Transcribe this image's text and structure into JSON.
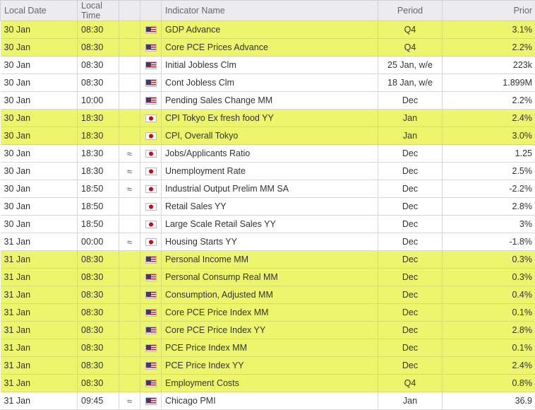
{
  "headers": {
    "date": "Local Date",
    "time": "Local Time",
    "indicator": "Indicator Name",
    "period": "Period",
    "prior": "Prior"
  },
  "rows": [
    {
      "date": "30 Jan",
      "time": "08:30",
      "rev": "",
      "flag": "us",
      "indicator": "GDP Advance",
      "period": "Q4",
      "prior": "3.1%",
      "hl": true
    },
    {
      "date": "30 Jan",
      "time": "08:30",
      "rev": "",
      "flag": "us",
      "indicator": "Core PCE Prices Advance",
      "period": "Q4",
      "prior": "2.2%",
      "hl": true
    },
    {
      "date": "30 Jan",
      "time": "08:30",
      "rev": "",
      "flag": "us",
      "indicator": "Initial Jobless Clm",
      "period": "25 Jan, w/e",
      "prior": "223k",
      "hl": false
    },
    {
      "date": "30 Jan",
      "time": "08:30",
      "rev": "",
      "flag": "us",
      "indicator": "Cont Jobless Clm",
      "period": "18 Jan, w/e",
      "prior": "1.899M",
      "hl": false
    },
    {
      "date": "30 Jan",
      "time": "10:00",
      "rev": "",
      "flag": "us",
      "indicator": "Pending Sales Change MM",
      "period": "Dec",
      "prior": "2.2%",
      "hl": false
    },
    {
      "date": "30 Jan",
      "time": "18:30",
      "rev": "",
      "flag": "jp",
      "indicator": "CPI Tokyo Ex fresh food YY",
      "period": "Jan",
      "prior": "2.4%",
      "hl": true
    },
    {
      "date": "30 Jan",
      "time": "18:30",
      "rev": "",
      "flag": "jp",
      "indicator": "CPI, Overall Tokyo",
      "period": "Jan",
      "prior": "3.0%",
      "hl": true
    },
    {
      "date": "30 Jan",
      "time": "18:30",
      "rev": "≈",
      "flag": "jp",
      "indicator": "Jobs/Applicants Ratio",
      "period": "Dec",
      "prior": "1.25",
      "hl": false
    },
    {
      "date": "30 Jan",
      "time": "18:30",
      "rev": "≈",
      "flag": "jp",
      "indicator": "Unemployment Rate",
      "period": "Dec",
      "prior": "2.5%",
      "hl": false
    },
    {
      "date": "30 Jan",
      "time": "18:50",
      "rev": "≈",
      "flag": "jp",
      "indicator": "Industrial Output Prelim MM SA",
      "period": "Dec",
      "prior": "-2.2%",
      "hl": false
    },
    {
      "date": "30 Jan",
      "time": "18:50",
      "rev": "",
      "flag": "jp",
      "indicator": "Retail Sales YY",
      "period": "Dec",
      "prior": "2.8%",
      "hl": false
    },
    {
      "date": "30 Jan",
      "time": "18:50",
      "rev": "",
      "flag": "jp",
      "indicator": "Large Scale Retail Sales YY",
      "period": "Dec",
      "prior": "3%",
      "hl": false
    },
    {
      "date": "31 Jan",
      "time": "00:00",
      "rev": "≈",
      "flag": "jp",
      "indicator": "Housing Starts YY",
      "period": "Dec",
      "prior": "-1.8%",
      "hl": false
    },
    {
      "date": "31 Jan",
      "time": "08:30",
      "rev": "",
      "flag": "us",
      "indicator": "Personal Income MM",
      "period": "Dec",
      "prior": "0.3%",
      "hl": true
    },
    {
      "date": "31 Jan",
      "time": "08:30",
      "rev": "",
      "flag": "us",
      "indicator": "Personal Consump Real MM",
      "period": "Dec",
      "prior": "0.3%",
      "hl": true
    },
    {
      "date": "31 Jan",
      "time": "08:30",
      "rev": "",
      "flag": "us",
      "indicator": "Consumption, Adjusted MM",
      "period": "Dec",
      "prior": "0.4%",
      "hl": true
    },
    {
      "date": "31 Jan",
      "time": "08:30",
      "rev": "",
      "flag": "us",
      "indicator": "Core PCE Price Index MM",
      "period": "Dec",
      "prior": "0.1%",
      "hl": true
    },
    {
      "date": "31 Jan",
      "time": "08:30",
      "rev": "",
      "flag": "us",
      "indicator": "Core PCE Price Index YY",
      "period": "Dec",
      "prior": "2.8%",
      "hl": true
    },
    {
      "date": "31 Jan",
      "time": "08:30",
      "rev": "",
      "flag": "us",
      "indicator": "PCE Price Index MM",
      "period": "Dec",
      "prior": "0.1%",
      "hl": true
    },
    {
      "date": "31 Jan",
      "time": "08:30",
      "rev": "",
      "flag": "us",
      "indicator": "PCE Price Index YY",
      "period": "Dec",
      "prior": "2.4%",
      "hl": true
    },
    {
      "date": "31 Jan",
      "time": "08:30",
      "rev": "",
      "flag": "us",
      "indicator": "Employment Costs",
      "period": "Q4",
      "prior": "0.8%",
      "hl": true
    },
    {
      "date": "31 Jan",
      "time": "09:45",
      "rev": "≈",
      "flag": "us",
      "indicator": "Chicago PMI",
      "period": "Jan",
      "prior": "36.9",
      "hl": false
    }
  ],
  "colors": {
    "highlight": "#ecf56b",
    "header_bg": "#ececef"
  },
  "icons": {
    "us": "us-flag-icon",
    "jp": "japan-flag-icon",
    "rev": "approx-icon"
  }
}
